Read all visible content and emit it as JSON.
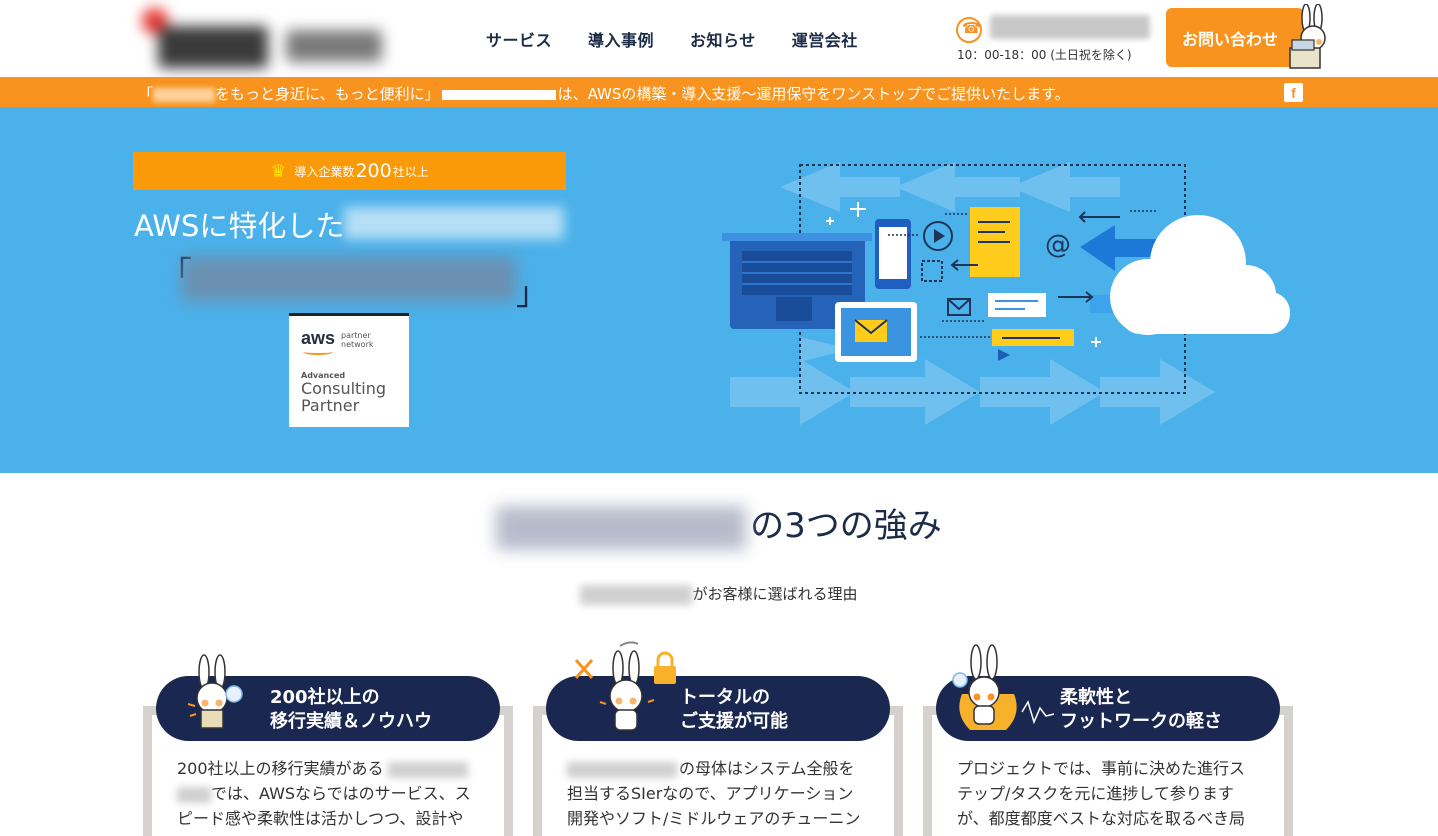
{
  "header": {
    "nav": [
      "サービス",
      "導入事例",
      "お知らせ",
      "運営会社"
    ],
    "hours": "10：00-18：00 (土日祝を除く)",
    "contact_label": "お問い合わせ"
  },
  "banner": {
    "part1": "「",
    "part2": "をもっと身近に、もっと便利に」",
    "part3": "は、AWSの構築・導入支援〜運用保守をワンストップでご提供いたします。",
    "facebook_icon": "f"
  },
  "hero": {
    "badge_pre": "導入企業数",
    "badge_num": "200",
    "badge_post": "社以上",
    "title": "AWSに特化した",
    "bracket_open": "「",
    "bracket_close": "」",
    "aws_word": "aws",
    "aws_partner_line1": "partner",
    "aws_partner_line2": "network",
    "aws_advanced": "Advanced",
    "aws_consulting": "Consulting",
    "aws_partner": "Partner"
  },
  "strengths": {
    "title_suffix": "の3つの強み",
    "subtitle_suffix": "がお客様に選ばれる理由",
    "cards": [
      {
        "head_line1": "200社以上の",
        "head_line2": "移行実績＆ノウハウ",
        "body_line1": "200社以上の移行実績がある",
        "body_line2": "では、AWSならではのサービス、ス",
        "body_line3": "ピード感や柔軟性は活かしつつ、設計や"
      },
      {
        "head_line1": "トータルの",
        "head_line2": "ご支援が可能",
        "body_line1": "の母体はシステム全般を",
        "body_line2": "担当するSIerなので、アプリケーション",
        "body_line3": "開発やソフト/ミドルウェアのチューニン"
      },
      {
        "head_line1": "柔軟性と",
        "head_line2": "フットワークの軽さ",
        "body_line1": "プロジェクトでは、事前に決めた進行ス",
        "body_line2": "テップ/タスクを元に進捗して参ります",
        "body_line3": "が、都度都度ベストな対応を取るべき局"
      }
    ]
  },
  "colors": {
    "orange": "#f7931e",
    "sky": "#4bb1ea",
    "navy": "#1a2750"
  },
  "icons": [
    "phone-icon",
    "facebook-icon",
    "crown-icon",
    "rabbit-mascot-icon",
    "cloud-icon",
    "laptop-icon",
    "tools-icon",
    "lock-icon"
  ]
}
